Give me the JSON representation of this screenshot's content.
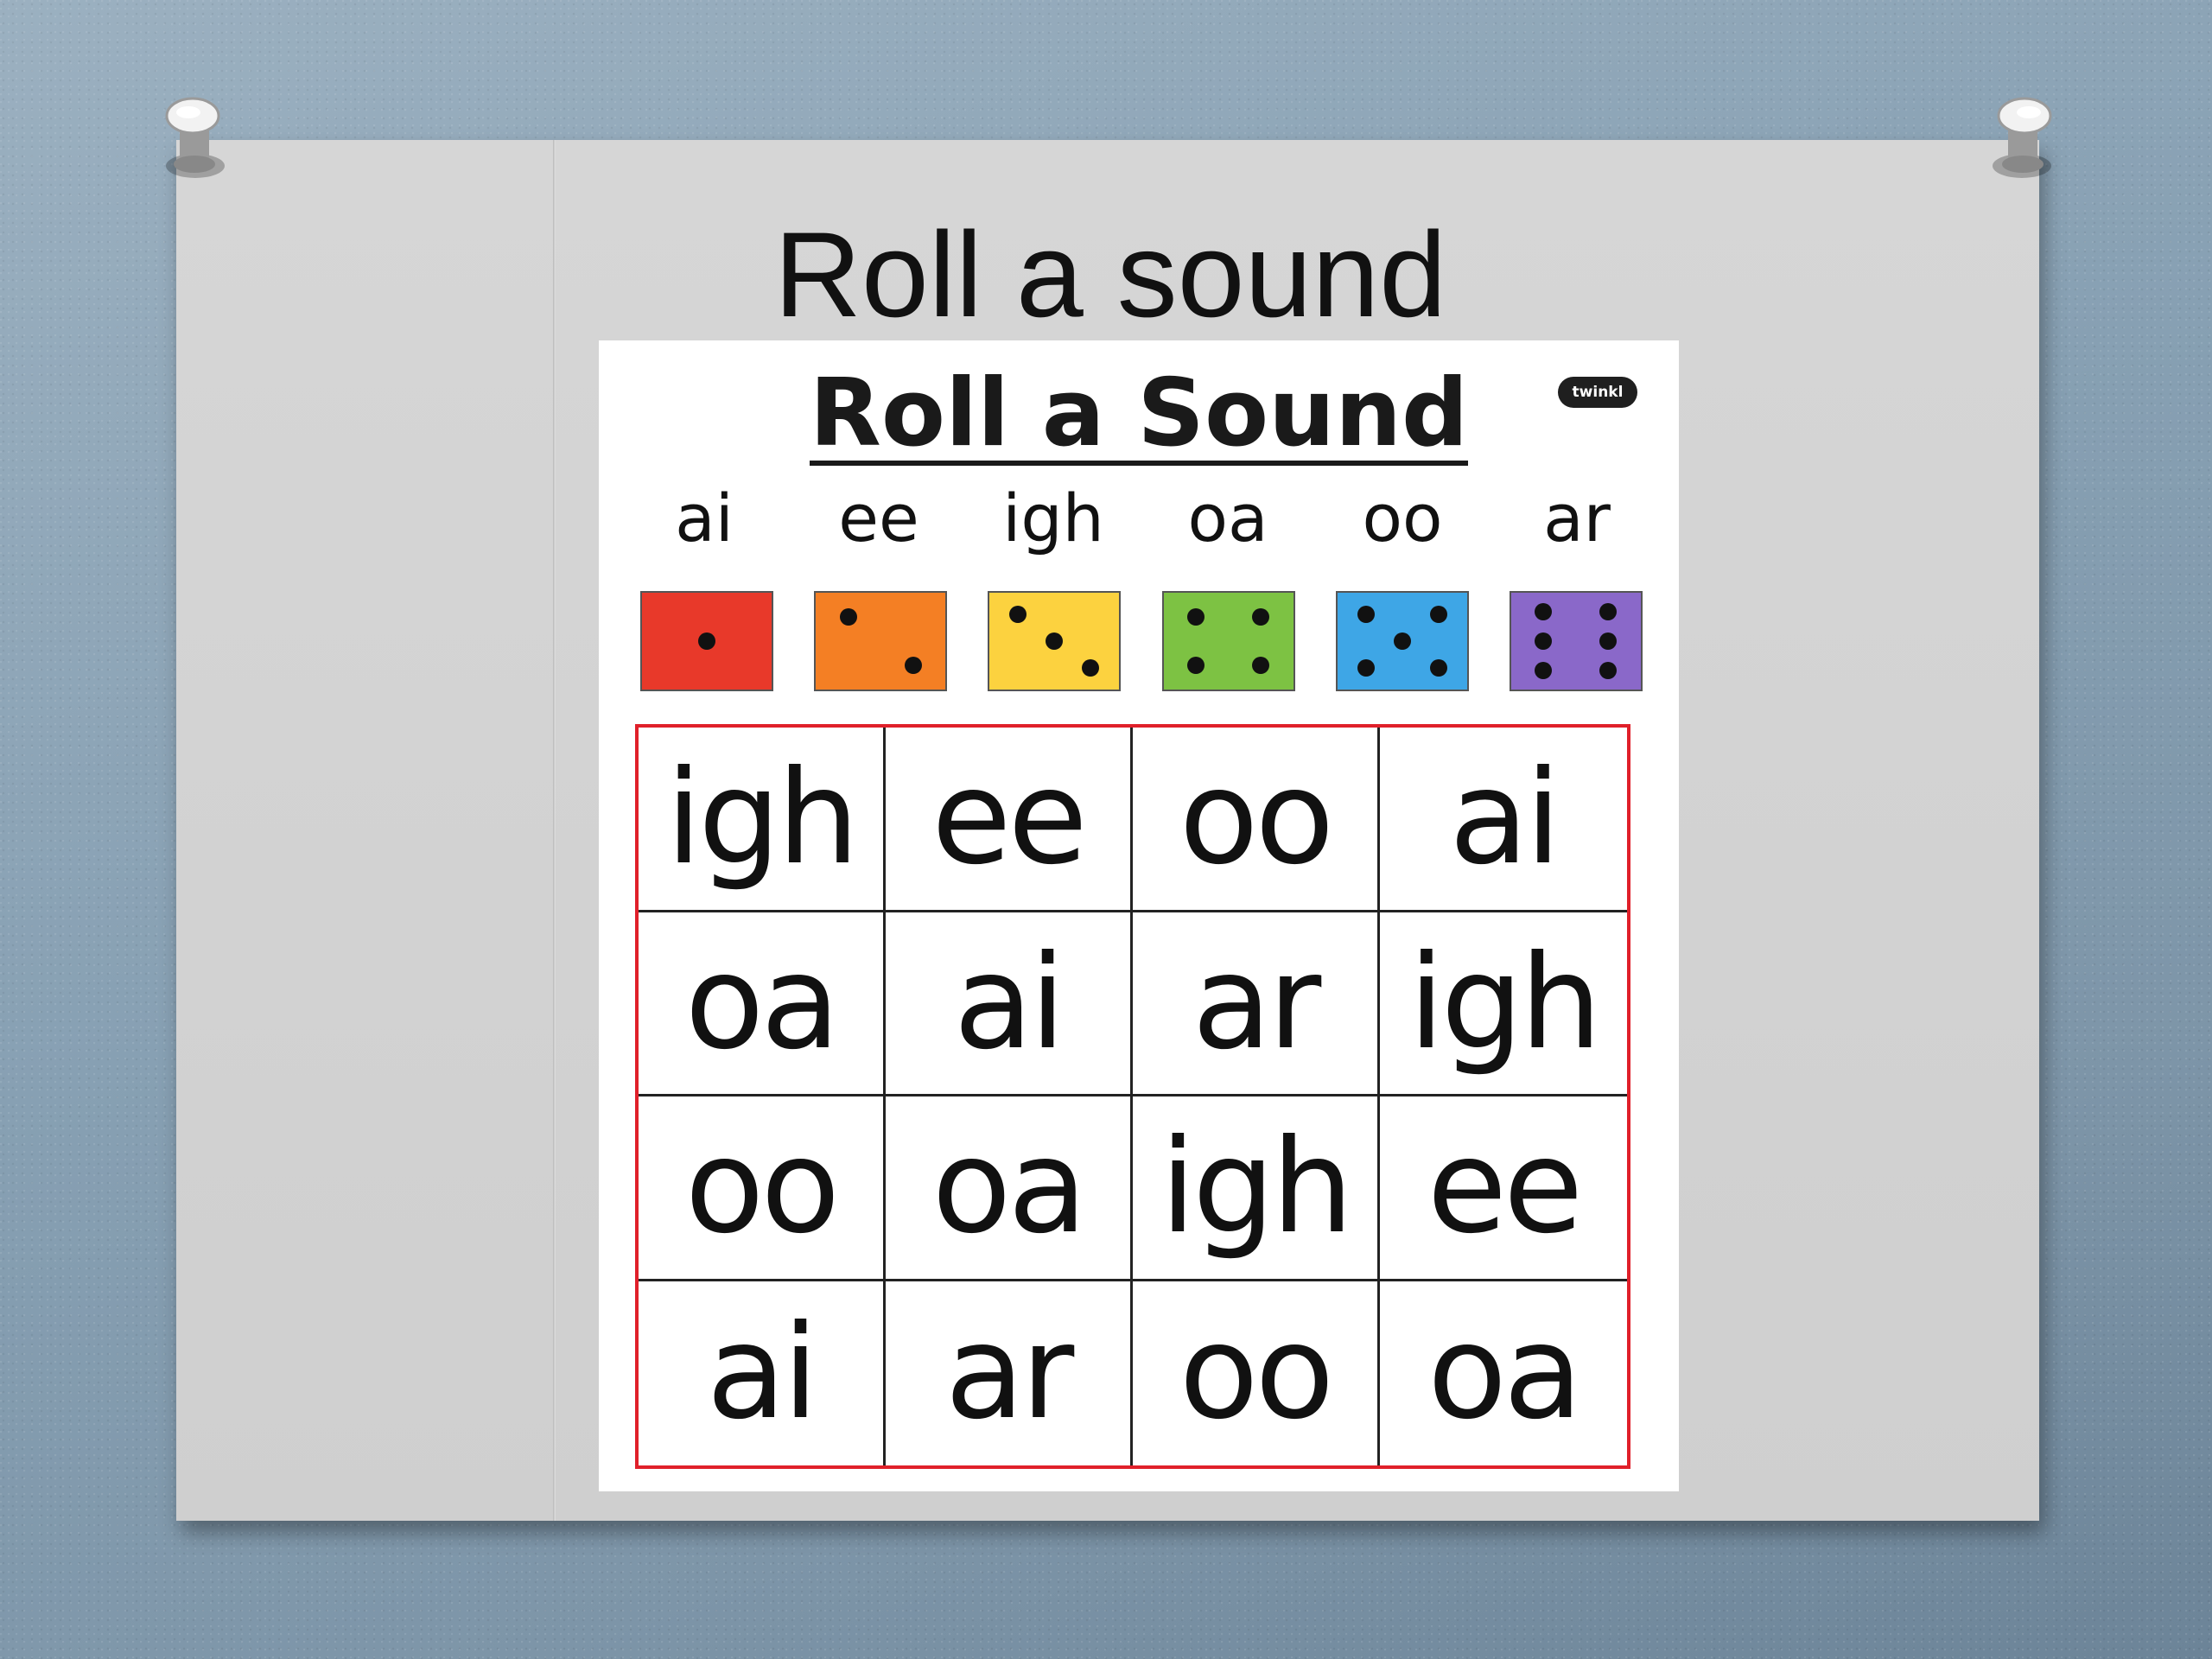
{
  "slide": {
    "title": "Roll a sound"
  },
  "worksheet": {
    "title": "Roll a Sound",
    "logo_text": "twinkl",
    "sounds": [
      "ai",
      "ee",
      "igh",
      "oa",
      "oo",
      "ar"
    ],
    "dice": [
      {
        "pips": 1,
        "color": "#e8392a"
      },
      {
        "pips": 2,
        "color": "#f47f24"
      },
      {
        "pips": 3,
        "color": "#fcd23f"
      },
      {
        "pips": 4,
        "color": "#7dc243"
      },
      {
        "pips": 5,
        "color": "#3ea6e6"
      },
      {
        "pips": 6,
        "color": "#8a68c9"
      }
    ],
    "grid": [
      [
        "igh",
        "ee",
        "oo",
        "ai"
      ],
      [
        "oa",
        "ai",
        "ar",
        "igh"
      ],
      [
        "oo",
        "oa",
        "igh",
        "ee"
      ],
      [
        "ai",
        "ar",
        "oo",
        "oa"
      ]
    ],
    "grid_border_color": "#e0202a"
  }
}
